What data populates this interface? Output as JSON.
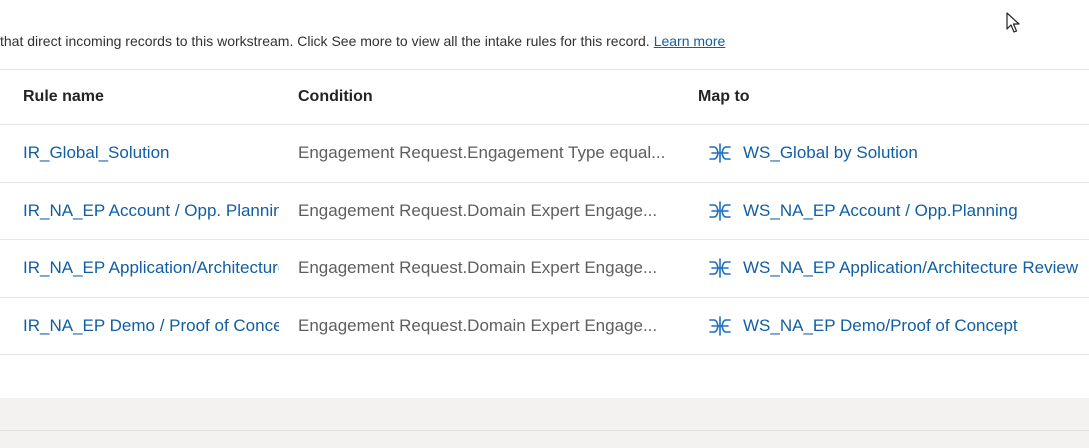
{
  "description": {
    "text": "that direct incoming records to this workstream. Click See more to view all the intake rules for this record.",
    "link": "Learn more"
  },
  "columns": {
    "rule_name": "Rule name",
    "condition": "Condition",
    "map_to": "Map to"
  },
  "rows": [
    {
      "rule_name": "IR_Global_Solution",
      "condition": "Engagement Request.Engagement Type equal...",
      "map_to": "WS_Global by Solution",
      "map_icon": "workstream-icon"
    },
    {
      "rule_name": "IR_NA_EP Account / Opp. Planning",
      "condition": "Engagement Request.Domain Expert Engage...",
      "map_to": "WS_NA_EP Account / Opp.Planning",
      "map_icon": "workstream-icon"
    },
    {
      "rule_name": "IR_NA_EP Application/Architecture",
      "condition": "Engagement Request.Domain Expert Engage...",
      "map_to": "WS_NA_EP Application/Architecture Review",
      "map_icon": "workstream-icon"
    },
    {
      "rule_name": "IR_NA_EP Demo / Proof of Concept",
      "condition": "Engagement Request.Domain Expert Engage...",
      "map_to": "WS_NA_EP Demo/Proof of Concept",
      "map_icon": "workstream-icon"
    }
  ],
  "colors": {
    "link": "#115ea3",
    "text": "#242424",
    "muted": "#605e5c",
    "icon": "#1f6fbf"
  }
}
